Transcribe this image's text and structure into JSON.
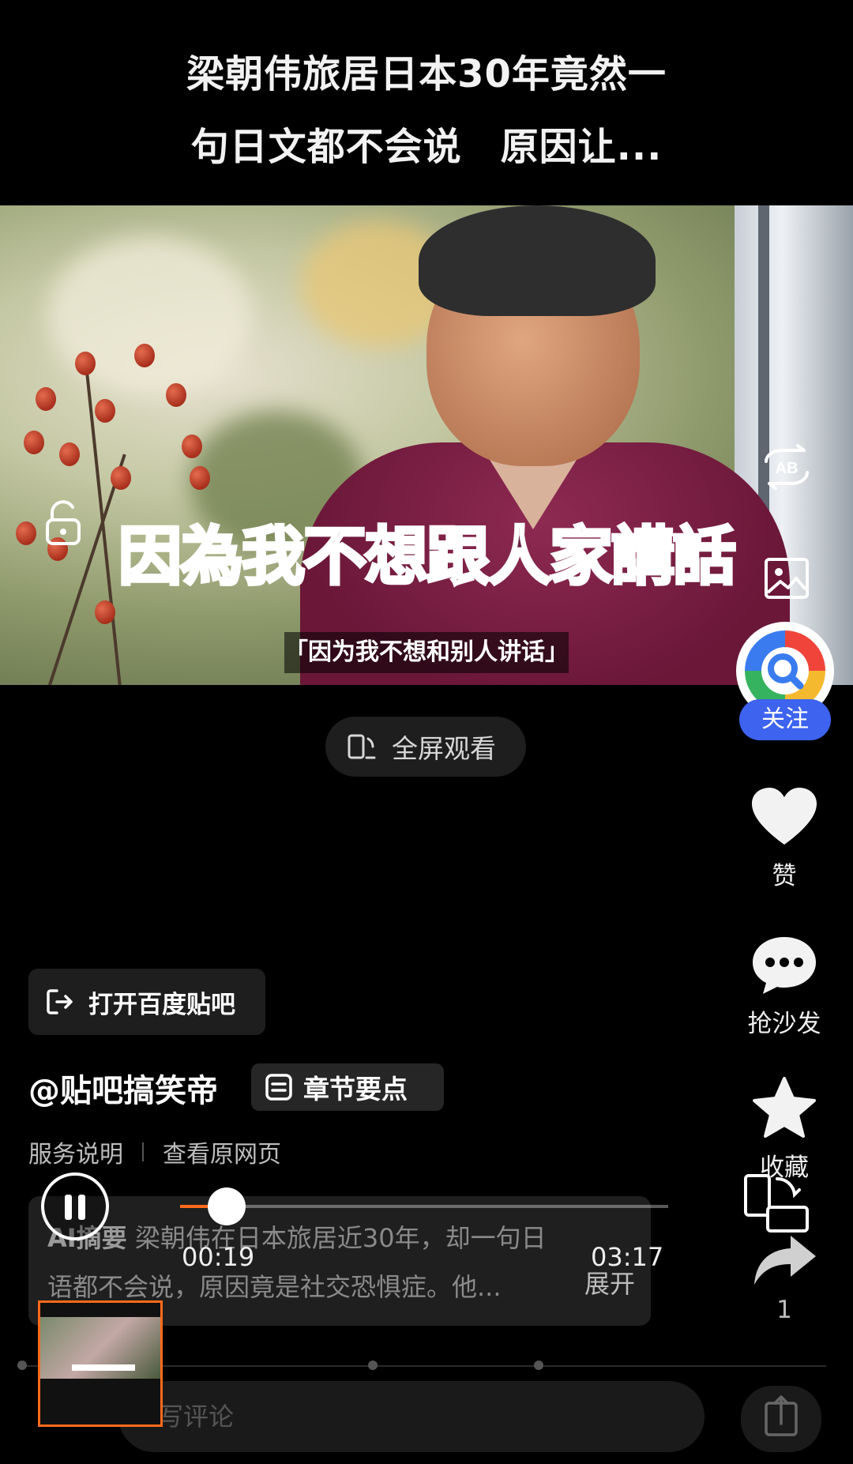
{
  "header": {
    "title_line1": "梁朝伟旅居日本30年竟然一",
    "title_line2": "句日文都不会说　原因让..."
  },
  "video": {
    "caption_large": "因為我不想跟人家講話",
    "caption_small": "「因为我不想和别人讲话」",
    "fullscreen_label": "全屏观看"
  },
  "sidebar": {
    "follow_label": "关注",
    "like_label": "赞",
    "comment_label": "抢沙发",
    "favorite_label": "收藏",
    "share_count": "1"
  },
  "info": {
    "open_app_label": "打开百度贴吧",
    "author": "@贴吧搞笑帝",
    "chapters_label": "章节要点",
    "service_label": "服务说明",
    "original_label": "查看原网页",
    "ai_tag": "AI摘要",
    "summary_line1": "梁朝伟在日本旅居近30年，却一句日",
    "summary_line2": "语都不会说，原因竟是社交恐惧症。他...",
    "expand_label": "展开"
  },
  "player": {
    "current_time": "00:19",
    "total_time": "03:17",
    "progress": 0.096
  },
  "comment": {
    "placeholder": "写评论"
  },
  "colors": {
    "accent": "#ff6a1a",
    "follow": "#3d63ef"
  }
}
